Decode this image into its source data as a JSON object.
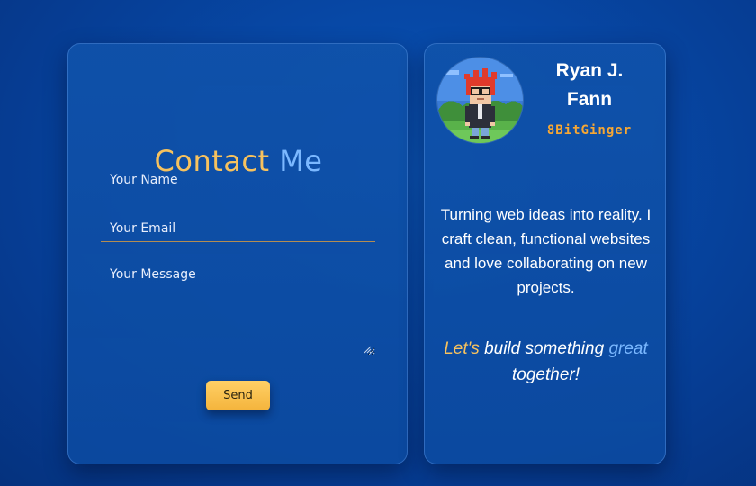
{
  "contact_form": {
    "title_part1": "Contact",
    "title_part2": "Me",
    "name_placeholder": "Your Name",
    "email_placeholder": "Your Email",
    "message_placeholder": "Your Message",
    "send_label": "Send"
  },
  "profile": {
    "name": "Ryan J. Fann",
    "handle": "8BitGinger",
    "bio": "Turning web ideas into reality. I craft clean, functional websites and love collaborating on new projects.",
    "cta_part1": "Let's",
    "cta_part2": "build something",
    "cta_part3": "great",
    "cta_part4": "together!"
  },
  "colors": {
    "background": "#0748a6",
    "accent_gold": "#f7c25e",
    "accent_blue": "#7bb8ff",
    "handle_orange": "#f7a733",
    "button": "#f4b43c"
  },
  "icons": {
    "avatar": "pixel-avatar-icon",
    "resize": "resize-grip-icon"
  }
}
